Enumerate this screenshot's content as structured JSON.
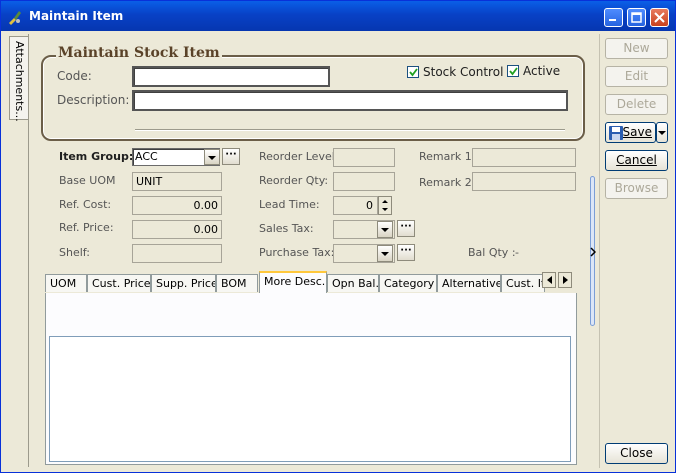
{
  "window": {
    "title": "Maintain Item"
  },
  "side_tab": {
    "label": "Attachments..."
  },
  "group": {
    "title": "Maintain Stock Item",
    "code_label": "Code:",
    "code_value": "",
    "description_label": "Description:",
    "description_value": "",
    "stock_control_label": "Stock Control",
    "stock_control_checked": true,
    "active_label": "Active",
    "active_checked": true
  },
  "fields": {
    "item_group_label": "Item Group:",
    "item_group_value": "ACC",
    "base_uom_label": "Base UOM",
    "base_uom_value": "UNIT",
    "ref_cost_label": "Ref. Cost:",
    "ref_cost_value": "0.00",
    "ref_price_label": "Ref. Price:",
    "ref_price_value": "0.00",
    "shelf_label": "Shelf:",
    "shelf_value": "",
    "reorder_level_label": "Reorder Level:",
    "reorder_level_value": "",
    "reorder_qty_label": "Reorder Qty:",
    "reorder_qty_value": "",
    "lead_time_label": "Lead Time:",
    "lead_time_value": "0",
    "sales_tax_label": "Sales Tax:",
    "sales_tax_value": "",
    "purchase_tax_label": "Purchase Tax:",
    "purchase_tax_value": "",
    "remark1_label": "Remark 1:",
    "remark1_value": "",
    "remark2_label": "Remark 2:",
    "remark2_value": "",
    "bal_qty_label": "Bal Qty :",
    "bal_qty_value": "-"
  },
  "tabs": [
    {
      "label": "UOM"
    },
    {
      "label": "Cust. Price"
    },
    {
      "label": "Supp. Price"
    },
    {
      "label": "BOM"
    },
    {
      "label": "More Desc."
    },
    {
      "label": "Opn Bal."
    },
    {
      "label": "Category"
    },
    {
      "label": "Alternative"
    },
    {
      "label": "Cust. Item"
    }
  ],
  "active_tab": "More Desc.",
  "more_desc": {
    "text": ""
  },
  "actions": {
    "new": "New",
    "edit": "Edit",
    "delete": "Delete",
    "save": "Save",
    "cancel": "Cancel",
    "browse": "Browse",
    "close": "Close"
  },
  "colors": {
    "accent": "#0a5fe7",
    "group_title": "#5a4228",
    "tab_highlight": "#ffc83c"
  }
}
